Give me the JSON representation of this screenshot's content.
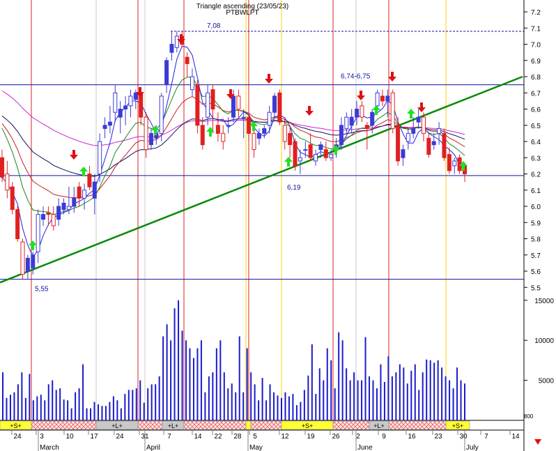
{
  "header": {
    "line1": "Triangle ascending (23/05/23)",
    "line2": "PTBWLPT"
  },
  "footer": {
    "month_labels": [
      "March",
      "April",
      "May",
      "June",
      "July"
    ],
    "day_labels": [
      "24",
      "3",
      "10",
      "17",
      "24",
      "31",
      "7",
      "14",
      "22",
      "28",
      "5",
      "12",
      "19",
      "26",
      "2",
      "9",
      "16",
      "23",
      "30",
      "7",
      "14"
    ],
    "signal_labels": [
      "+S+",
      "+L+",
      "+L+",
      "+S+",
      "+L+",
      "+S+"
    ],
    "page_marker": "800"
  },
  "colors": {
    "up_candle": "#3b3bd6",
    "down_candle": "#e02020",
    "volume": "#1a1acc",
    "trendline": "#0a8a0a",
    "hline": "#1010a0",
    "ma_magenta": "#d020d0",
    "ma_navy": "#101060",
    "ma_red": "#c02020",
    "ma_green": "#208020",
    "ma_blue": "#2020e0",
    "buy_arrow": "#20e020",
    "sell_arrow": "#e01010",
    "band_yellow": "#ffff33",
    "band_hatch": "#e06060"
  },
  "chart_data": {
    "type": "candlestick",
    "title": "Triangle ascending (23/05/23)",
    "subtitle": "PTBWLPT",
    "y_axis": {
      "position": "right",
      "ylim": [
        5.45,
        7.25
      ],
      "ticks": [
        5.5,
        5.6,
        5.7,
        5.8,
        5.9,
        6.0,
        6.1,
        6.2,
        6.3,
        6.4,
        6.5,
        6.6,
        6.7,
        6.8,
        6.9,
        7.0,
        7.1,
        7.2
      ]
    },
    "volume_axis": {
      "ticks": [
        5000,
        10000,
        15000
      ],
      "ylim": [
        0,
        16500
      ]
    },
    "horizontal_levels": [
      {
        "value": 7.08,
        "label": "7,08",
        "style": "dashed"
      },
      {
        "value": 6.75,
        "label": "6,74-6,75",
        "style": "solid"
      },
      {
        "value": 6.19,
        "label": "6,19",
        "style": "solid"
      },
      {
        "value": 5.55,
        "label": "5,55",
        "style": "solid"
      }
    ],
    "trendline": {
      "start": {
        "date": "02/23",
        "value": 5.53
      },
      "end": {
        "date": "07/20",
        "value": 6.8
      }
    },
    "candles": [
      {
        "o": 6.3,
        "h": 6.35,
        "l": 6.15,
        "c": 6.18
      },
      {
        "o": 6.2,
        "h": 6.28,
        "l": 6.05,
        "c": 6.1
      },
      {
        "o": 6.12,
        "h": 6.15,
        "l": 5.95,
        "c": 5.98
      },
      {
        "o": 5.98,
        "h": 6.0,
        "l": 5.78,
        "c": 5.8
      },
      {
        "o": 5.78,
        "h": 5.8,
        "l": 5.55,
        "c": 5.58
      },
      {
        "o": 5.6,
        "h": 5.7,
        "l": 5.55,
        "c": 5.68
      },
      {
        "o": 5.62,
        "h": 5.72,
        "l": 5.58,
        "c": 5.7
      },
      {
        "o": 5.72,
        "h": 5.98,
        "l": 5.65,
        "c": 5.95
      },
      {
        "o": 5.92,
        "h": 6.0,
        "l": 5.88,
        "c": 5.95
      },
      {
        "o": 5.96,
        "h": 6.0,
        "l": 5.88,
        "c": 5.95
      },
      {
        "o": 5.95,
        "h": 6.0,
        "l": 5.85,
        "c": 5.88
      },
      {
        "o": 5.92,
        "h": 6.05,
        "l": 5.88,
        "c": 6.0
      },
      {
        "o": 5.98,
        "h": 6.05,
        "l": 5.95,
        "c": 6.02
      },
      {
        "o": 5.98,
        "h": 6.12,
        "l": 5.95,
        "c": 6.0
      },
      {
        "o": 6.0,
        "h": 6.12,
        "l": 5.96,
        "c": 6.05
      },
      {
        "o": 6.12,
        "h": 6.15,
        "l": 6.0,
        "c": 6.05
      },
      {
        "o": 6.05,
        "h": 6.14,
        "l": 5.98,
        "c": 6.1
      },
      {
        "o": 6.2,
        "h": 6.25,
        "l": 6.1,
        "c": 6.12
      },
      {
        "o": 6.05,
        "h": 6.2,
        "l": 5.95,
        "c": 6.15
      },
      {
        "o": 6.2,
        "h": 6.45,
        "l": 6.15,
        "c": 6.4
      },
      {
        "o": 6.48,
        "h": 6.55,
        "l": 6.42,
        "c": 6.5
      },
      {
        "o": 6.5,
        "h": 6.62,
        "l": 6.45,
        "c": 6.52
      },
      {
        "o": 6.58,
        "h": 6.75,
        "l": 6.52,
        "c": 6.7
      },
      {
        "o": 6.55,
        "h": 6.65,
        "l": 6.45,
        "c": 6.6
      },
      {
        "o": 6.6,
        "h": 6.68,
        "l": 6.5,
        "c": 6.62
      },
      {
        "o": 6.62,
        "h": 6.72,
        "l": 6.55,
        "c": 6.68
      },
      {
        "o": 6.66,
        "h": 6.72,
        "l": 6.6,
        "c": 6.7
      },
      {
        "o": 6.7,
        "h": 6.72,
        "l": 6.5,
        "c": 6.55
      },
      {
        "o": 6.55,
        "h": 6.58,
        "l": 6.3,
        "c": 6.35
      },
      {
        "o": 6.38,
        "h": 6.48,
        "l": 6.35,
        "c": 6.45
      },
      {
        "o": 6.42,
        "h": 6.5,
        "l": 6.38,
        "c": 6.45
      },
      {
        "o": 6.45,
        "h": 6.7,
        "l": 6.4,
        "c": 6.68
      },
      {
        "o": 6.75,
        "h": 6.92,
        "l": 6.7,
        "c": 6.9
      },
      {
        "o": 6.95,
        "h": 7.08,
        "l": 6.9,
        "c": 7.0
      },
      {
        "o": 6.98,
        "h": 7.08,
        "l": 6.95,
        "c": 7.05
      },
      {
        "o": 7.05,
        "h": 7.08,
        "l": 6.98,
        "c": 7.0
      },
      {
        "o": 6.92,
        "h": 6.95,
        "l": 6.8,
        "c": 6.88
      },
      {
        "o": 6.72,
        "h": 6.85,
        "l": 6.68,
        "c": 6.8
      },
      {
        "o": 6.75,
        "h": 6.78,
        "l": 6.45,
        "c": 6.5
      },
      {
        "o": 6.5,
        "h": 6.55,
        "l": 6.35,
        "c": 6.38
      },
      {
        "o": 6.55,
        "h": 6.75,
        "l": 6.5,
        "c": 6.7
      },
      {
        "o": 6.72,
        "h": 6.75,
        "l": 6.45,
        "c": 6.6
      },
      {
        "o": 6.5,
        "h": 6.58,
        "l": 6.4,
        "c": 6.45
      },
      {
        "o": 6.45,
        "h": 6.5,
        "l": 6.35,
        "c": 6.4
      },
      {
        "o": 6.5,
        "h": 6.55,
        "l": 6.45,
        "c": 6.5
      },
      {
        "o": 6.55,
        "h": 6.72,
        "l": 6.52,
        "c": 6.68
      },
      {
        "o": 6.68,
        "h": 6.72,
        "l": 6.55,
        "c": 6.6
      },
      {
        "o": 6.55,
        "h": 6.6,
        "l": 6.42,
        "c": 6.55
      },
      {
        "o": 6.55,
        "h": 6.58,
        "l": 6.4,
        "c": 6.45
      },
      {
        "o": 6.45,
        "h": 6.5,
        "l": 6.3,
        "c": 6.35
      },
      {
        "o": 6.42,
        "h": 6.48,
        "l": 6.38,
        "c": 6.45
      },
      {
        "o": 6.45,
        "h": 6.5,
        "l": 6.42,
        "c": 6.48
      },
      {
        "o": 6.5,
        "h": 6.62,
        "l": 6.45,
        "c": 6.58
      },
      {
        "o": 6.58,
        "h": 6.7,
        "l": 6.55,
        "c": 6.68
      },
      {
        "o": 6.7,
        "h": 6.72,
        "l": 6.5,
        "c": 6.52
      },
      {
        "o": 6.5,
        "h": 6.55,
        "l": 6.35,
        "c": 6.4
      },
      {
        "o": 6.45,
        "h": 6.5,
        "l": 6.3,
        "c": 6.38
      },
      {
        "o": 6.4,
        "h": 6.42,
        "l": 6.22,
        "c": 6.25
      },
      {
        "o": 6.28,
        "h": 6.35,
        "l": 6.2,
        "c": 6.3
      },
      {
        "o": 6.35,
        "h": 6.4,
        "l": 6.3,
        "c": 6.35
      },
      {
        "o": 6.38,
        "h": 6.45,
        "l": 6.28,
        "c": 6.3
      },
      {
        "o": 6.28,
        "h": 6.35,
        "l": 6.25,
        "c": 6.32
      },
      {
        "o": 6.35,
        "h": 6.4,
        "l": 6.3,
        "c": 6.38
      },
      {
        "o": 6.35,
        "h": 6.4,
        "l": 6.28,
        "c": 6.3
      },
      {
        "o": 6.3,
        "h": 6.35,
        "l": 6.28,
        "c": 6.32
      },
      {
        "o": 6.35,
        "h": 6.42,
        "l": 6.3,
        "c": 6.38
      },
      {
        "o": 6.38,
        "h": 6.55,
        "l": 6.35,
        "c": 6.5
      },
      {
        "o": 6.48,
        "h": 6.58,
        "l": 6.45,
        "c": 6.55
      },
      {
        "o": 6.5,
        "h": 6.6,
        "l": 6.45,
        "c": 6.55
      },
      {
        "o": 6.55,
        "h": 6.65,
        "l": 6.5,
        "c": 6.6
      },
      {
        "o": 6.62,
        "h": 6.65,
        "l": 6.52,
        "c": 6.55
      },
      {
        "o": 6.5,
        "h": 6.52,
        "l": 6.35,
        "c": 6.48
      },
      {
        "o": 6.5,
        "h": 6.6,
        "l": 6.45,
        "c": 6.58
      },
      {
        "o": 6.62,
        "h": 6.72,
        "l": 6.6,
        "c": 6.7
      },
      {
        "o": 6.68,
        "h": 6.72,
        "l": 6.62,
        "c": 6.65
      },
      {
        "o": 6.65,
        "h": 6.72,
        "l": 6.55,
        "c": 6.68
      },
      {
        "o": 6.7,
        "h": 6.72,
        "l": 6.45,
        "c": 6.48
      },
      {
        "o": 6.5,
        "h": 6.55,
        "l": 6.25,
        "c": 6.28
      },
      {
        "o": 6.3,
        "h": 6.38,
        "l": 6.25,
        "c": 6.35
      },
      {
        "o": 6.4,
        "h": 6.48,
        "l": 6.35,
        "c": 6.45
      },
      {
        "o": 6.45,
        "h": 6.55,
        "l": 6.42,
        "c": 6.48
      },
      {
        "o": 6.52,
        "h": 6.6,
        "l": 6.48,
        "c": 6.55
      },
      {
        "o": 6.55,
        "h": 6.58,
        "l": 6.4,
        "c": 6.45
      },
      {
        "o": 6.42,
        "h": 6.45,
        "l": 6.3,
        "c": 6.32
      },
      {
        "o": 6.38,
        "h": 6.45,
        "l": 6.35,
        "c": 6.4
      },
      {
        "o": 6.45,
        "h": 6.52,
        "l": 6.38,
        "c": 6.48
      },
      {
        "o": 6.45,
        "h": 6.48,
        "l": 6.28,
        "c": 6.3
      },
      {
        "o": 6.32,
        "h": 6.36,
        "l": 6.2,
        "c": 6.22
      },
      {
        "o": 6.25,
        "h": 6.3,
        "l": 6.2,
        "c": 6.28
      },
      {
        "o": 6.3,
        "h": 6.32,
        "l": 6.2,
        "c": 6.22
      },
      {
        "o": 6.25,
        "h": 6.26,
        "l": 6.15,
        "c": 6.2
      }
    ],
    "volume": [
      6000,
      2800,
      3200,
      3500,
      4500,
      6000,
      2800,
      5800,
      2500,
      3000,
      3200,
      2500,
      4500,
      5000,
      3800,
      4000,
      2600,
      2500,
      1500,
      3500,
      4000,
      7000,
      1500,
      1500,
      2300,
      2000,
      1800,
      1800,
      2300,
      3000,
      2500,
      1500,
      3300,
      3800,
      3800,
      4000,
      5000,
      2200,
      4000,
      4500,
      4500,
      5500,
      10500,
      12000,
      10000,
      14000,
      15000,
      11200,
      10000,
      9000,
      7800,
      9000,
      10000,
      3500,
      5500,
      6000,
      9000,
      10000,
      6000,
      4000,
      4600,
      3500,
      10500,
      3500,
      9000,
      6000,
      4500,
      2500,
      5300,
      2500,
      4500,
      3500,
      3100,
      2800,
      3500,
      3000,
      3300,
      1900,
      2300,
      3800,
      5600,
      9500,
      3300,
      6500,
      5000,
      9000,
      7500,
      4000,
      11000,
      10000,
      6500,
      5000,
      6000,
      5000,
      5000,
      10400,
      5500,
      5000,
      4000,
      7000,
      4800,
      8000,
      5500,
      6000,
      7000,
      6600,
      4600,
      6200,
      7000,
      3800,
      6000,
      7600,
      7500,
      7200,
      7500,
      6600,
      5500,
      5000,
      4000,
      6600,
      5000,
      4600
    ]
  }
}
